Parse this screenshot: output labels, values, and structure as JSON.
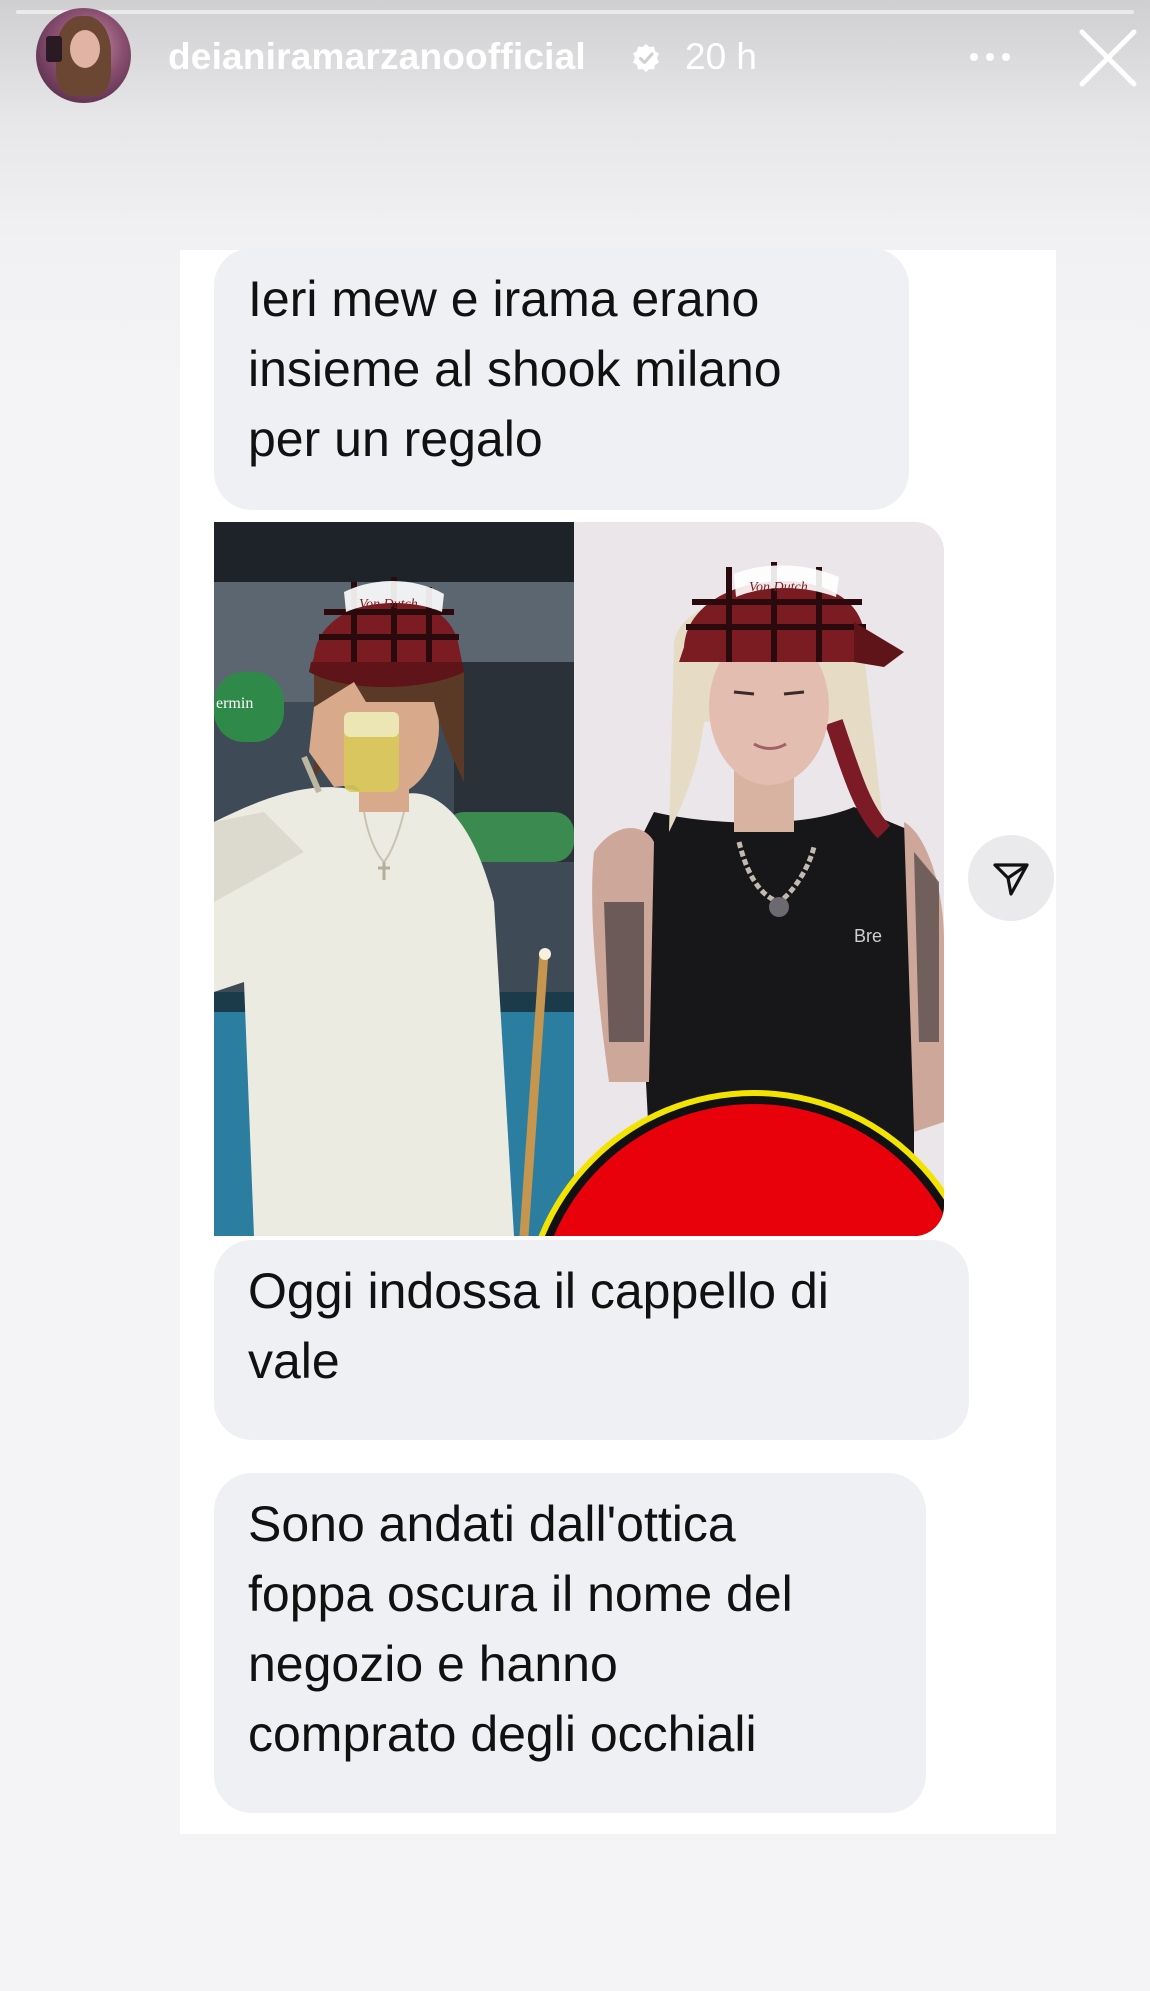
{
  "story": {
    "username": "deianiramarzanoofficial",
    "time": "20 h"
  },
  "messages": [
    {
      "text": "Ieri mew e irama erano\ninsieme al shook milano\nper un regalo"
    },
    {
      "text": "Oggi indossa il cappello di\nvale"
    },
    {
      "text": "Sono andati dall'ottica\nfoppa oscura il nome del\nnegozio e hanno\ncomprato degli occhiali"
    }
  ],
  "photo": {
    "cap_text_left": "Von Dutch",
    "cap_text_right": "Von Dutch",
    "sign_text": "ermin"
  },
  "icons": {
    "verified": "verified-badge-icon",
    "more": "more-options-icon",
    "close": "close-icon",
    "share": "send-icon"
  },
  "colors": {
    "bubble": "#eff0f3",
    "redaction": "#e8000b",
    "redaction_ring": "#f2e300"
  }
}
